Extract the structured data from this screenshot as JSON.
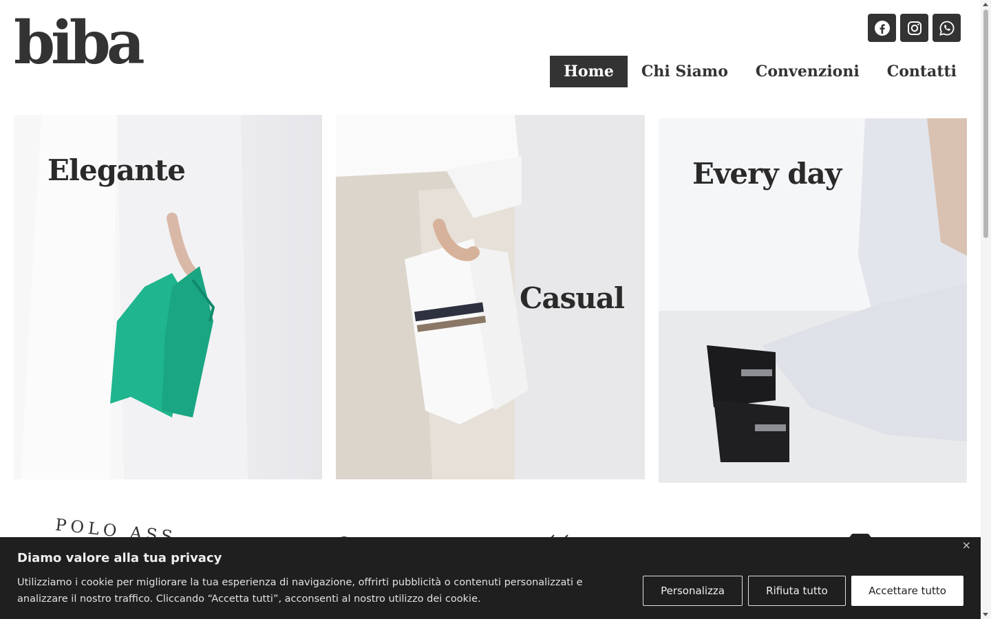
{
  "header": {
    "logo": "biba",
    "social": [
      "facebook-icon",
      "instagram-icon",
      "whatsapp-icon"
    ],
    "nav": [
      {
        "label": "Home",
        "active": true
      },
      {
        "label": "Chi Siamo",
        "active": false
      },
      {
        "label": "Convenzioni",
        "active": false
      },
      {
        "label": "Contatti",
        "active": false
      }
    ]
  },
  "cards": [
    {
      "caption": "Elegante"
    },
    {
      "caption": "Casual"
    },
    {
      "caption": "Every day"
    }
  ],
  "brands_strip": {
    "partial_text": "POLO ASS"
  },
  "cookie": {
    "title": "Diamo valore alla tua privacy",
    "text": "Utilizziamo i cookie per migliorare la tua esperienza di navigazione, offrirti pubblicità o contenuti personalizzati e analizzare il nostro traffico. Cliccando “Accetta tutti”, acconsenti al nostro utilizzo dei cookie.",
    "close": "×",
    "buttons": {
      "customize": "Personalizza",
      "reject": "Rifiuta tutto",
      "accept": "Accettare tutto"
    }
  },
  "colors": {
    "dark": "#333333",
    "banner": "#1f1f1f",
    "accent_green": "#1fb58e"
  }
}
